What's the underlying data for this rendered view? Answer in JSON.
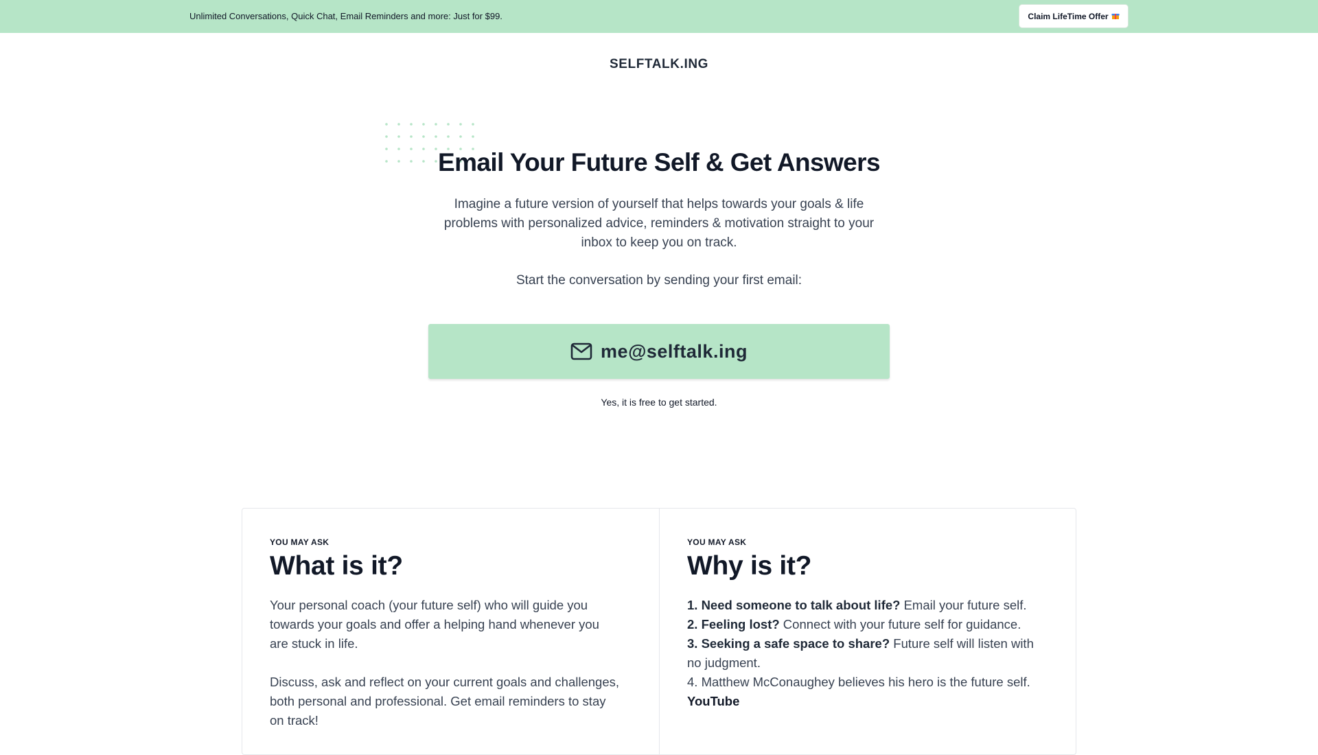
{
  "promo": {
    "text": "Unlimited Conversations, Quick Chat, Email Reminders and more: Just for $99.",
    "button_label": "Claim LifeTime Offer",
    "button_icon": "gift-icon"
  },
  "brand": "SELFTALK.ING",
  "hero": {
    "title": "Email Your Future Self & Get Answers",
    "description": "Imagine a future version of yourself that helps towards your goals & life problems with personalized advice, reminders & motivation straight to your inbox to keep you on track.",
    "cta_text": "Start the conversation by sending your first email:",
    "email_button": "me@selftalk.ing",
    "email_icon": "mail-icon",
    "free_note": "Yes, it is free to get started."
  },
  "cards": {
    "what": {
      "eyebrow": "YOU MAY ASK",
      "title": "What is it?",
      "paragraphs": [
        "Your personal coach (your future self) who will guide you towards your goals and offer a helping hand whenever you are stuck in life.",
        "Discuss, ask and reflect on your current goals and challenges, both personal and professional. Get email reminders to stay on track!"
      ]
    },
    "why": {
      "eyebrow": "YOU MAY ASK",
      "title": "Why is it?",
      "items": [
        {
          "bold": "1. Need someone to talk about life?",
          "rest": " Email your future self."
        },
        {
          "bold": "2. Feeling lost?",
          "rest": " Connect with your future self for guidance."
        },
        {
          "bold": "3. Seeking a safe space to share?",
          "rest": " Future self will listen with no judgment."
        },
        {
          "bold": "",
          "rest": "4. Matthew McConaughey believes his hero is the future self."
        }
      ],
      "link": "YouTube"
    }
  },
  "colors": {
    "accent_green": "#b6e5c7",
    "dot_color": "#b6e5c7"
  }
}
